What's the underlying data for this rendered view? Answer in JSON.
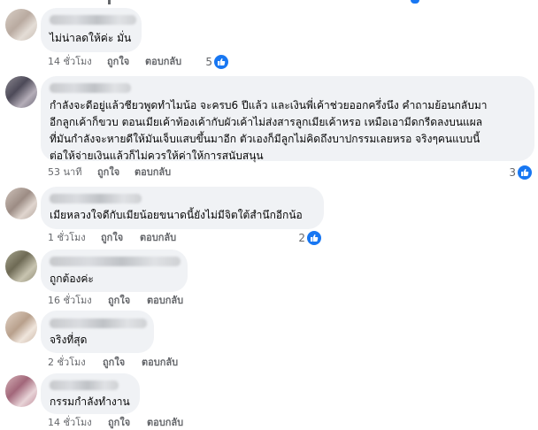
{
  "comments": [
    {
      "text_lines": [
        "ไม่น่าลดให้ค่ะ มั่น"
      ],
      "time": "14 ชั่วโมง",
      "like_label": "ถูกใจ",
      "reply_label": "ตอบกลับ",
      "reactions": "5"
    },
    {
      "text_lines": [
        "กำลังจะดีอยู่แล้วชียวพูดทำไมน้อ จะครบ6 ปีแล้ว และเงินพี่เค้าช่วยออกครึ่งนึง คำถามย้อนกลับมา",
        "อีกลูกเค้าก็ขวบ ตอนเมียเค้าท้องเค้ากับผัวเค้าไม่ส่งสารลูกเมียเค้าหรอ เหมือเอามีดกรีดลงบนแผล",
        "ที่มันกำลังจะหายดีให้มันเจ็บแสบขึ้นมาอีก ตัวเองก็มีลูกไม่คิดถึงบาปกรรมเลยหรอ จริงๆคนแบบนี้",
        "ต่อให้จ่ายเงินแล้วก็ไม่ควรให้ค่าให้การสนับสนุน"
      ],
      "time": "53 นาที",
      "like_label": "ถูกใจ",
      "reply_label": "ตอบกลับ",
      "reactions": "3"
    },
    {
      "text_lines": [
        "เมียหลวงใจดีกับเมียน้อยขนาดนี้ยังไม่มีจิตใต้สำนึกอีกน้อ"
      ],
      "time": "1 ชั่วโมง",
      "like_label": "ถูกใจ",
      "reply_label": "ตอบกลับ",
      "reactions": "2"
    },
    {
      "text_lines": [
        "ถูกต้องค่ะ"
      ],
      "time": "16 ชั่วโมง",
      "like_label": "ถูกใจ",
      "reply_label": "ตอบกลับ",
      "reactions": ""
    },
    {
      "text_lines": [
        "จริงที่สุด"
      ],
      "time": "2 ชั่วโมง",
      "like_label": "ถูกใจ",
      "reply_label": "ตอบกลับ",
      "reactions": ""
    },
    {
      "text_lines": [
        "กรรมกำลังทำงาน"
      ],
      "time": "14 ชั่วโมง",
      "like_label": "ถูกใจ",
      "reply_label": "ตอบกลับ",
      "reactions": ""
    }
  ],
  "colors": {
    "bubble": "#f0f2f5",
    "meta_text": "#65676b",
    "like_blue": "#1877f2"
  },
  "icons": {
    "reaction": "like-thumb-icon"
  }
}
